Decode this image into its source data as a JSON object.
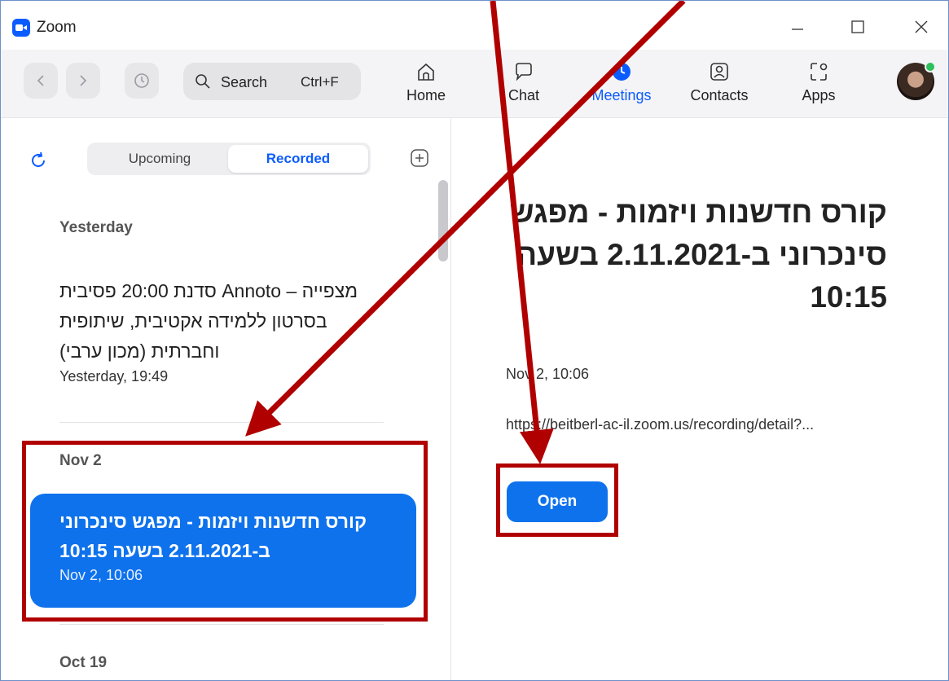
{
  "window": {
    "title": "Zoom"
  },
  "search": {
    "label": "Search",
    "shortcut": "Ctrl+F"
  },
  "nav": {
    "tabs": [
      {
        "label": "Home",
        "icon": "home-icon"
      },
      {
        "label": "Chat",
        "icon": "chat-icon"
      },
      {
        "label": "Meetings",
        "icon": "clock-icon",
        "active": true
      },
      {
        "label": "Contacts",
        "icon": "contacts-icon"
      },
      {
        "label": "Apps",
        "icon": "apps-icon"
      }
    ]
  },
  "recordings": {
    "tabs": [
      {
        "label": "Upcoming"
      },
      {
        "label": "Recorded",
        "active": true
      }
    ],
    "groups": [
      {
        "heading": "Yesterday",
        "items": [
          {
            "title": "מצפייה – Annoto סדנת 20:00 פסיבית בסרטון ללמידה אקטיבית, שיתופית וחברתית (מכון ערבי)",
            "date": "Yesterday, 19:49"
          }
        ]
      },
      {
        "heading": "Nov 2",
        "items": [
          {
            "title": "קורס חדשנות ויזמות - מפגש סינכרוני ב-2.11.2021 בשעה 10:15",
            "date": "Nov 2, 10:06",
            "selected": true
          }
        ]
      },
      {
        "heading": "Oct 19",
        "items": []
      }
    ]
  },
  "detail": {
    "title": "קורס חדשנות ויזמות - מפגש סינכרוני ב-2.11.2021 בשעה 10:15",
    "date": "Nov 2, 10:06",
    "link": "https://beitberl-ac-il.zoom.us/recording/detail?...",
    "open_label": "Open"
  },
  "colors": {
    "accent": "#0e72ed",
    "annotation": "#b00000"
  }
}
